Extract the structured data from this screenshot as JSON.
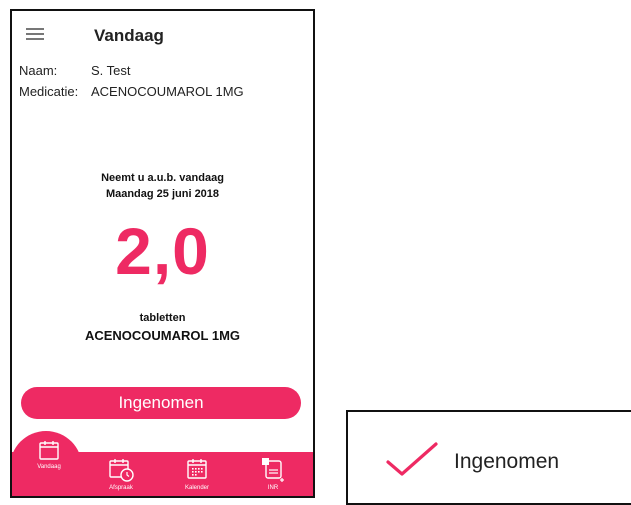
{
  "header": {
    "title": "Vandaag",
    "menu_icon": "hamburger-menu-icon"
  },
  "patient": {
    "name_label": "Naam:",
    "name_value": "S. Test",
    "medication_label": "Medicatie:",
    "medication_value": "ACENOCOUMAROL 1MG"
  },
  "instruction": {
    "line1": "Neemt u a.u.b. vandaag",
    "line2": "Maandag 25 juni 2018"
  },
  "dose": {
    "amount": "2,0",
    "unit": "tabletten",
    "drug": "ACENOCOUMAROL 1MG"
  },
  "taken_button": {
    "label": "Ingenomen"
  },
  "nav": {
    "items": [
      {
        "label": "Vandaag",
        "icon": "calendar-icon"
      },
      {
        "label": "Afspraak",
        "icon": "calendar-clock-icon"
      },
      {
        "label": "Kalender",
        "icon": "calendar-grid-icon"
      },
      {
        "label": "INR",
        "icon": "note-add-icon"
      }
    ]
  },
  "detail": {
    "label": "Ingenomen",
    "icon": "checkmark-icon"
  },
  "colors": {
    "accent": "#ee2a63",
    "text": "#1a1a1a"
  }
}
